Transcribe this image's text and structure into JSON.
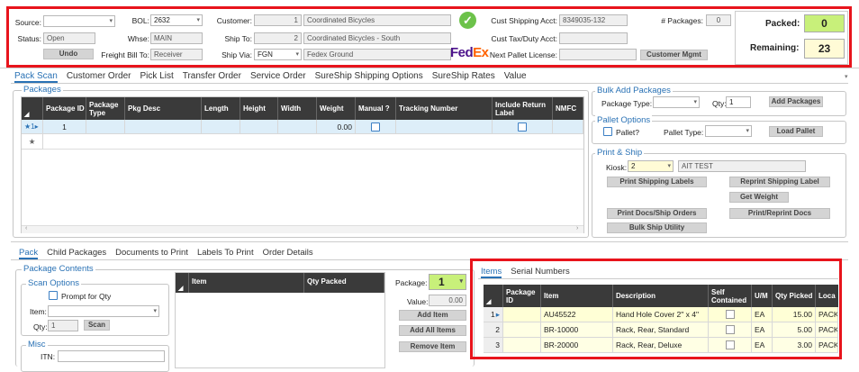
{
  "header": {
    "source_label": "Source:",
    "source_value": "",
    "status_label": "Status:",
    "status_value": "Open",
    "undo_label": "Undo",
    "bol_label": "BOL:",
    "bol_value": "2632",
    "whse_label": "Whse:",
    "whse_value": "MAIN",
    "freight_bill_label": "Freight Bill To:",
    "freight_bill_value": "Receiver",
    "customer_label": "Customer:",
    "customer_num": "1",
    "customer_name": "Coordinated Bicycles",
    "ship_to_label": "Ship To:",
    "ship_to_num": "2",
    "ship_to_name": "Coordinated Bicycles - South",
    "ship_via_label": "Ship Via:",
    "ship_via_value": "FGN",
    "ship_via_name": "Fedex Ground",
    "cust_ship_acct_label": "Cust Shipping Acct:",
    "cust_ship_acct_value": "8349035-132",
    "cust_tax_label": "Cust Tax/Duty Acct:",
    "cust_tax_value": "",
    "next_pallet_label": "Next Pallet License:",
    "next_pallet_value": "",
    "customer_mgmt_label": "Customer Mgmt",
    "packages_count_label": "# Packages:",
    "packages_count_value": "0",
    "packed_label": "Packed:",
    "packed_value": "0",
    "remaining_label": "Remaining:",
    "remaining_value": "23",
    "fedex_fe": "Fed",
    "fedex_ex": "Ex"
  },
  "main_tabs": [
    "Pack Scan",
    "Customer Order",
    "Pick List",
    "Transfer Order",
    "Service Order",
    "SureShip Shipping Options",
    "SureShip Rates",
    "Value"
  ],
  "packages": {
    "title": "Packages",
    "columns": [
      "Package ID",
      "Package Type",
      "Pkg Desc",
      "Length",
      "Height",
      "Width",
      "Weight",
      "Manual ?",
      "Tracking Number",
      "Include Return Label",
      "NMFC"
    ],
    "row": {
      "indicator": "1",
      "package_id": "1",
      "weight": "0.00"
    }
  },
  "bulk_add": {
    "title": "Bulk Add Packages",
    "package_type_label": "Package Type:",
    "qty_label": "Qty:",
    "qty_value": "1",
    "add_button": "Add Packages"
  },
  "pallet": {
    "title": "Pallet Options",
    "pallet_label": "Pallet?",
    "pallet_type_label": "Pallet Type:",
    "load_button": "Load Pallet"
  },
  "print_ship": {
    "title": "Print & Ship",
    "kiosk_label": "Kiosk:",
    "kiosk_value": "2",
    "kiosk_name": "AIT TEST",
    "print_labels": "Print Shipping Labels",
    "reprint_label": "Reprint Shipping Label",
    "get_weight": "Get Weight",
    "print_docs": "Print Docs/Ship Orders",
    "reprint_docs": "Print/Reprint Docs",
    "bulk_ship": "Bulk Ship Utility"
  },
  "lower_tabs": [
    "Pack",
    "Child Packages",
    "Documents to Print",
    "Labels To Print",
    "Order Details"
  ],
  "package_contents": {
    "title": "Package Contents",
    "scan_options_title": "Scan Options",
    "prompt_qty_label": "Prompt for Qty",
    "item_label": "Item:",
    "qty_label": "Qty:",
    "qty_value": "1",
    "scan_button": "Scan",
    "misc_title": "Misc",
    "itn_label": "ITN:",
    "col_item": "Item",
    "col_qty_packed": "Qty Packed",
    "package_label": "Package:",
    "package_value": "1",
    "value_label": "Value:",
    "value_value": "0.00",
    "add_item": "Add Item",
    "add_all_items": "Add All Items",
    "remove_item": "Remove Item"
  },
  "items_panel": {
    "tabs": [
      "Items",
      "Serial Numbers"
    ],
    "columns": [
      "Package ID",
      "Item",
      "Description",
      "Self Contained",
      "U/M",
      "Qty Picked",
      "Loca"
    ],
    "rows": [
      {
        "num": "1",
        "item": "AU45522",
        "description": "Hand Hole Cover 2\" x 4\"",
        "um": "EA",
        "qty": "15.00",
        "loc": "PACK"
      },
      {
        "num": "2",
        "item": "BR-10000",
        "description": "Rack, Rear, Standard",
        "um": "EA",
        "qty": "5.00",
        "loc": "PACK"
      },
      {
        "num": "3",
        "item": "BR-20000",
        "description": "Rack, Rear, Deluxe",
        "um": "EA",
        "qty": "3.00",
        "loc": "PACK"
      }
    ]
  },
  "colors": {
    "accent": "#2a72b5",
    "highlight_red": "#e8141c",
    "packed_bg": "#c8f07a",
    "remaining_bg": "#fffbd6",
    "row_yellow": "#ffffd6",
    "grid_header": "#3a3a3a"
  }
}
